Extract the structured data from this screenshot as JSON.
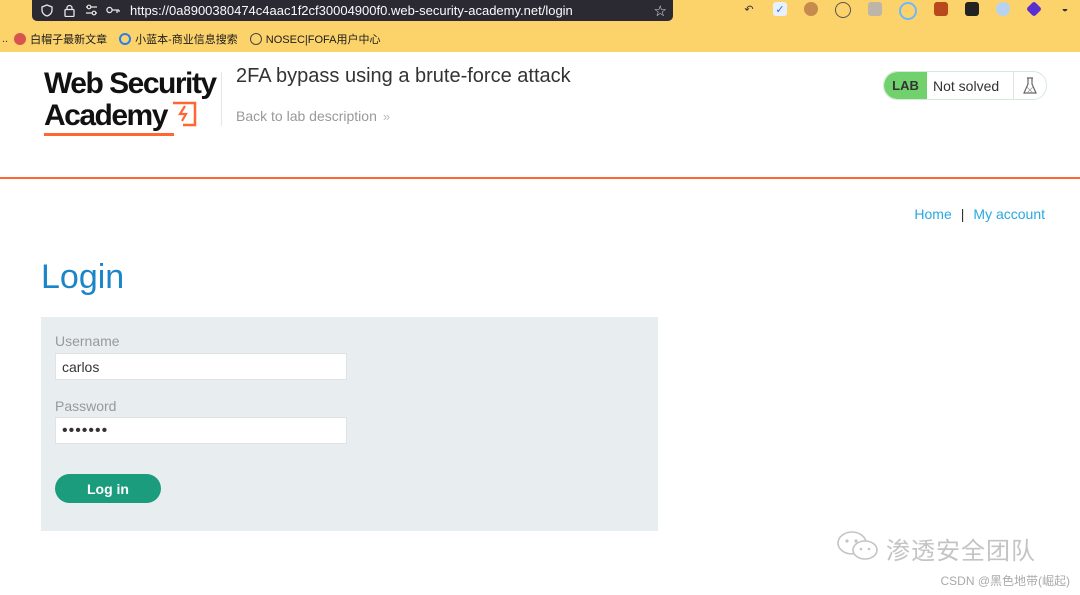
{
  "browser": {
    "url": "https://0a8900380474c4aac1f2cf30004900f0.web-security-academy.net/login",
    "chrome_color": "#fcd36b",
    "bookmarks": [
      {
        "label": "白帽子最新文章",
        "icon_color": "#d9534f"
      },
      {
        "label": "小蓝本-商业信息搜索",
        "icon_color": "#2b7de9"
      },
      {
        "label": "NOSEC|FOFA用户中心",
        "icon_color": "#444444"
      }
    ],
    "extensions": [
      "back-arrow-icon",
      "vpn-icon",
      "cookie-icon",
      "cookie2-icon",
      "puzzle-icon",
      "circle-icon",
      "grid-icon",
      "glasses-icon",
      "toggle-icon",
      "diamond-icon",
      "hat-icon"
    ]
  },
  "lab": {
    "logo_line1": "Web Security",
    "logo_line2": "Academy",
    "title": "2FA bypass using a brute-force attack",
    "back_link": "Back to lab description",
    "badge": "LAB",
    "status": "Not solved",
    "accent_color": "#ff6633"
  },
  "nav": {
    "home": "Home",
    "separator": "|",
    "my_account": "My account"
  },
  "page": {
    "heading": "Login",
    "username_label": "Username",
    "username_value": "carlos",
    "password_label": "Password",
    "password_value": "•••••••",
    "login_button": "Log in"
  },
  "watermark": {
    "team": "渗透安全团队",
    "credit": "CSDN @黑色地带(崛起)"
  }
}
